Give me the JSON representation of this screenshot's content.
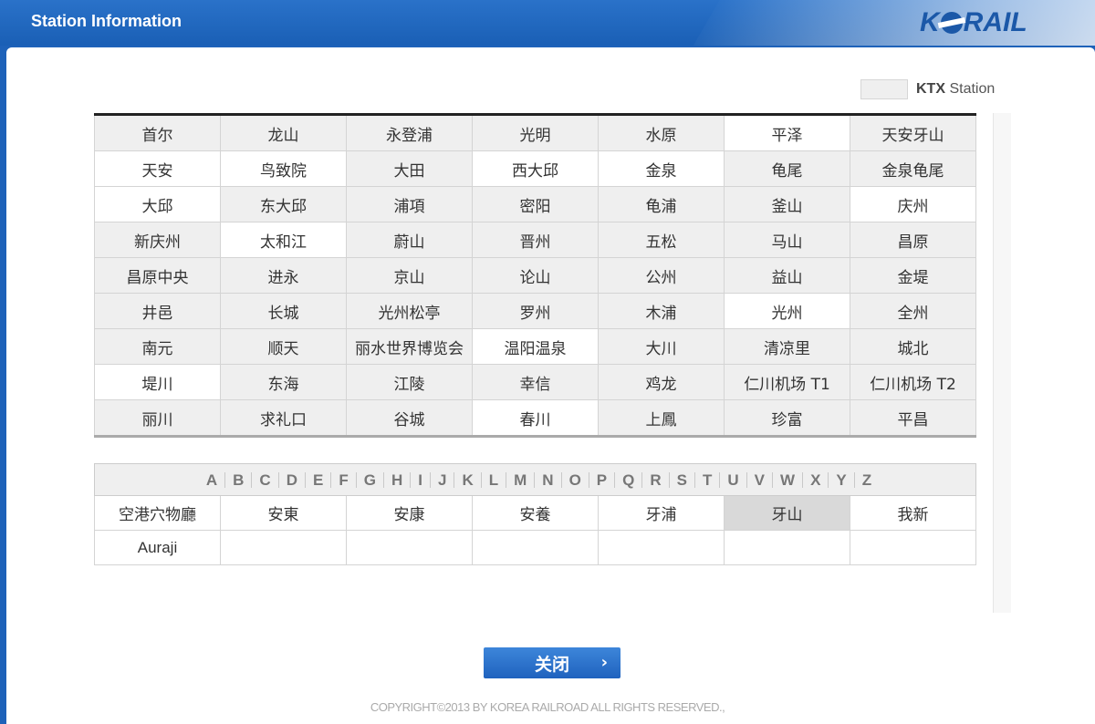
{
  "header": {
    "title": "Station Information",
    "logo_text": "KORAIL"
  },
  "legend": {
    "label": "KTX",
    "suffix": "Station"
  },
  "stations": [
    [
      "首尔",
      "龙山",
      "永登浦",
      "光明",
      "水原",
      "平泽",
      "天安牙山"
    ],
    [
      "天安",
      "鸟致院",
      "大田",
      "西大邱",
      "金泉",
      "龟尾",
      "金泉龟尾"
    ],
    [
      "大邱",
      "东大邱",
      "浦項",
      "密阳",
      "龟浦",
      "釜山",
      "庆州"
    ],
    [
      "新庆州",
      "太和江",
      "蔚山",
      "晋州",
      "五松",
      "马山",
      "昌原"
    ],
    [
      "昌原中央",
      "进永",
      "京山",
      "论山",
      "公州",
      "益山",
      "金堤"
    ],
    [
      "井邑",
      "长城",
      "光州松亭",
      "罗州",
      "木浦",
      "光州",
      "全州"
    ],
    [
      "南元",
      "顺天",
      "丽水世界博览会",
      "温阳温泉",
      "大川",
      "清凉里",
      "城北"
    ],
    [
      "堤川",
      "东海",
      "江陵",
      "幸信",
      "鸡龙",
      "仁川机场 T1",
      "仁川机场 T2"
    ],
    [
      "丽川",
      "求礼口",
      "谷城",
      "春川",
      "上鳳",
      "珍富",
      "平昌"
    ]
  ],
  "alphabet": [
    "A",
    "B",
    "C",
    "D",
    "E",
    "F",
    "G",
    "H",
    "I",
    "J",
    "K",
    "L",
    "M",
    "N",
    "O",
    "P",
    "Q",
    "R",
    "S",
    "T",
    "U",
    "V",
    "W",
    "X",
    "Y",
    "Z"
  ],
  "results": [
    [
      "空港穴物廳",
      "安東",
      "安康",
      "安養",
      "牙浦",
      "牙山",
      "我新"
    ],
    [
      "Auraji",
      "",
      "",
      "",
      "",
      "",
      ""
    ]
  ],
  "close_button": {
    "label": "关闭",
    "chevron": "›"
  },
  "copyright": "COPYRIGHT©2013 BY KOREA RAILROAD ALL RIGHTS RESERVED.,"
}
